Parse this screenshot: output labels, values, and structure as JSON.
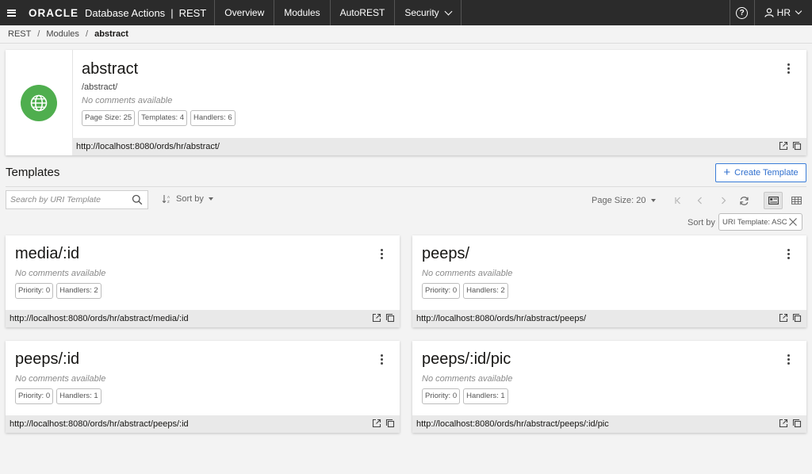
{
  "topbar": {
    "logo": "ORACLE",
    "product": "Database Actions",
    "separator": "|",
    "section": "REST",
    "nav": [
      "Overview",
      "Modules",
      "AutoREST",
      "Security"
    ],
    "user": "HR"
  },
  "breadcrumb": {
    "items": [
      "REST",
      "Modules"
    ],
    "current": "abstract",
    "separator": "/"
  },
  "module": {
    "name": "abstract",
    "path": "/abstract/",
    "comment": "No comments available",
    "chips": [
      "Page Size: 25",
      "Templates: 4",
      "Handlers: 6"
    ],
    "url": "http://localhost:8080/ords/hr/abstract/",
    "icon_color": "#4fae4e"
  },
  "templates": {
    "title": "Templates",
    "create_label": "Create Template",
    "search_placeholder": "Search by URI Template",
    "sort_by_label": "Sort by",
    "page_size_label": "Page Size: 20",
    "sort_label": "Sort by",
    "sort_chip": "URI Template: ASC",
    "items": [
      {
        "name": "media/:id",
        "comment": "No comments available",
        "chips": [
          "Priority: 0",
          "Handlers: 2"
        ],
        "url": "http://localhost:8080/ords/hr/abstract/media/:id"
      },
      {
        "name": "peeps/",
        "comment": "No comments available",
        "chips": [
          "Priority: 0",
          "Handlers: 2"
        ],
        "url": "http://localhost:8080/ords/hr/abstract/peeps/"
      },
      {
        "name": "peeps/:id",
        "comment": "No comments available",
        "chips": [
          "Priority: 0",
          "Handlers: 1"
        ],
        "url": "http://localhost:8080/ords/hr/abstract/peeps/:id"
      },
      {
        "name": "peeps/:id/pic",
        "comment": "No comments available",
        "chips": [
          "Priority: 0",
          "Handlers: 1"
        ],
        "url": "http://localhost:8080/ords/hr/abstract/peeps/:id/pic"
      }
    ]
  },
  "icons": {
    "menu": "hamburger-icon",
    "help": "help-icon",
    "user": "user-icon",
    "globe": "globe-icon",
    "open": "external-link-icon",
    "copy": "copy-icon",
    "search": "search-icon",
    "sort": "sort-icon",
    "first": "first-page-icon",
    "prev": "previous-page-icon",
    "next": "next-page-icon",
    "refresh": "refresh-icon",
    "card_view": "card-view-icon",
    "grid_view": "grid-view-icon",
    "clear": "close-icon",
    "more": "kebab-icon"
  }
}
